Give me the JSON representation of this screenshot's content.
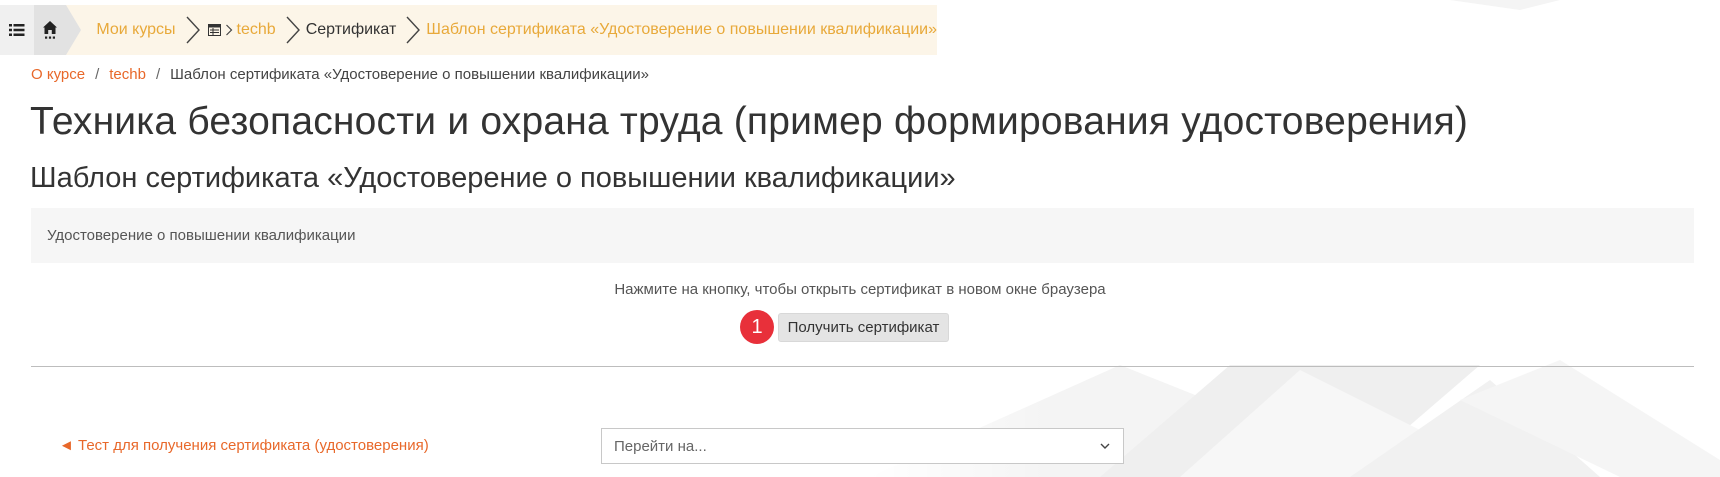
{
  "topbar": {
    "menu_icon": "list-icon",
    "home_icon": "home-icon",
    "course_icon": "course-table-icon",
    "items": [
      {
        "label": "Мои курсы"
      },
      {
        "label": "techb"
      },
      {
        "label": "Сертификат"
      },
      {
        "label": "Шаблон сертификата «Удостоверение о повышении квалификации»"
      }
    ]
  },
  "breadcrumb": {
    "items": [
      "О курсе",
      "techb"
    ],
    "separator": "/",
    "current": "Шаблон сертификата «Удостоверение о повышении квалификации»"
  },
  "page": {
    "title": "Техника безопасности и охрана труда (пример формирования удостоверения)",
    "subtitle": "Шаблон сертификата «Удостоверение о повышении квалификации»",
    "intro": "Удостоверение о повышении квалификации",
    "hint": "Нажмите на кнопку, чтобы открыть сертификат в новом окне браузера",
    "badge": "1",
    "get_button": "Получить сертификат"
  },
  "navigation": {
    "prev_link": "◄ Тест для получения сертификата (удостоверения)",
    "jump_placeholder": "Перейти на..."
  },
  "colors": {
    "link_orange": "#e8682a",
    "topbar_link": "#e8a93a",
    "badge_red": "#e8303a",
    "topbar_bg": "#fcf5e8"
  }
}
